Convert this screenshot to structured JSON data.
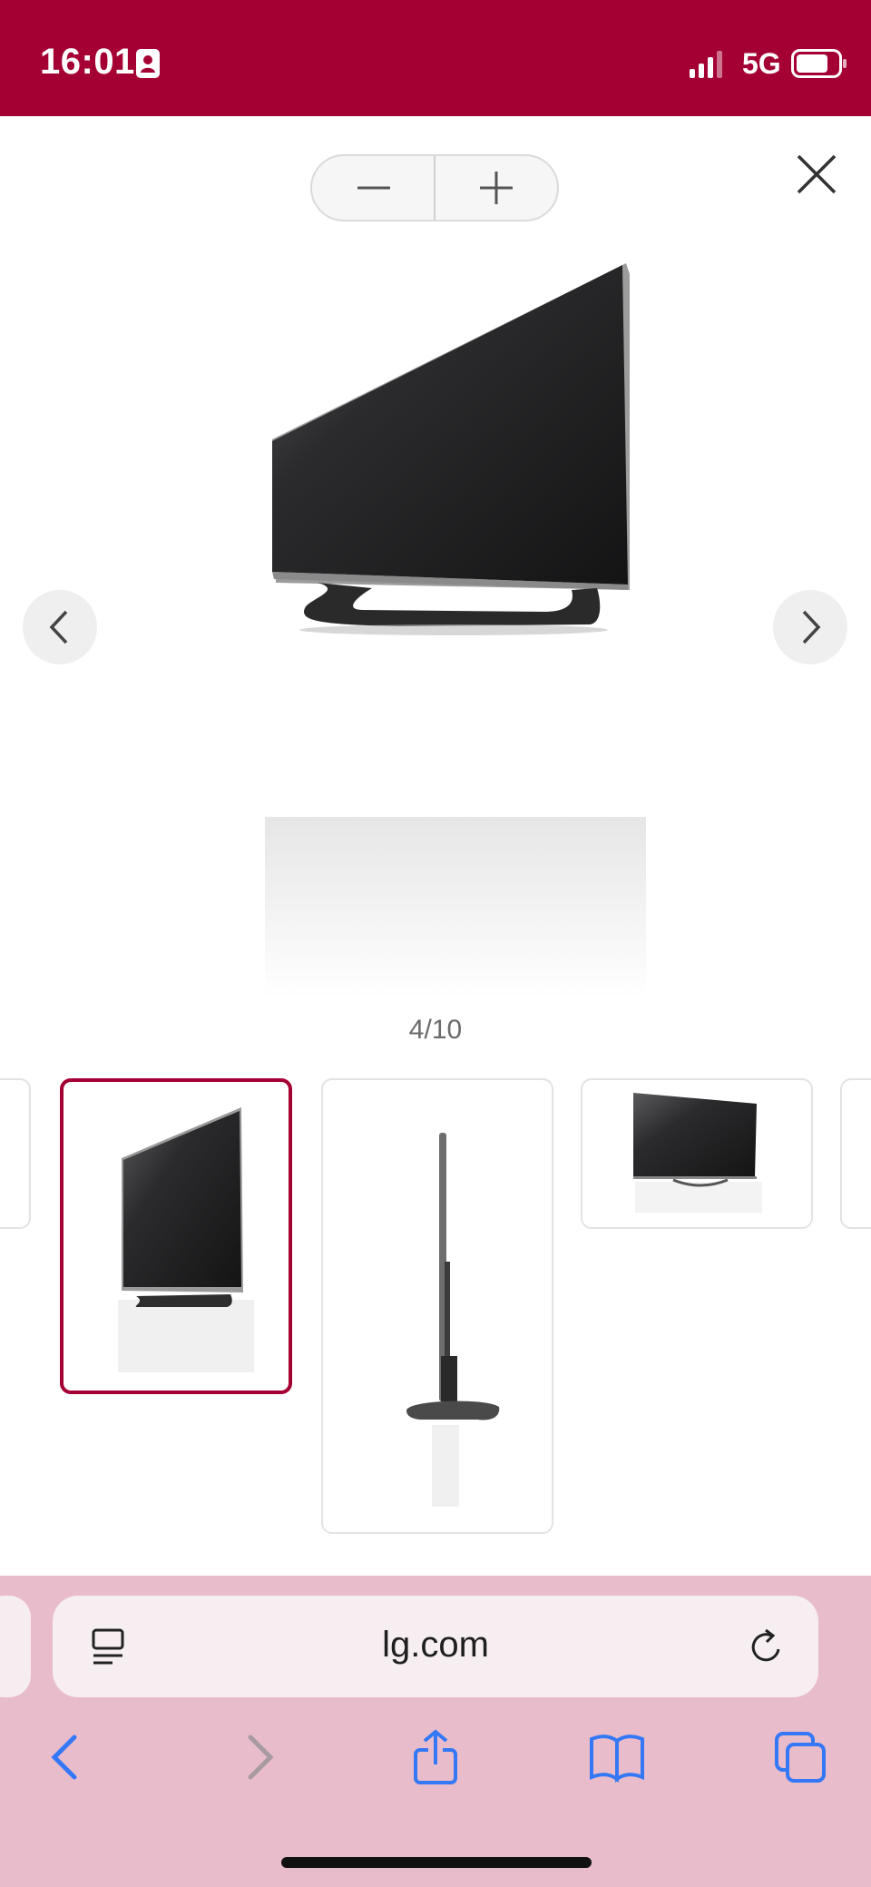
{
  "status_bar": {
    "time": "16:01",
    "network": "5G"
  },
  "viewer": {
    "counter": "4/10",
    "current_index": 4,
    "total": 10
  },
  "thumbnails": [
    {
      "label": "tv-angle-view",
      "active": true
    },
    {
      "label": "tv-side-view",
      "active": false
    },
    {
      "label": "tv-front-view",
      "active": false
    }
  ],
  "browser": {
    "url": "lg.com"
  },
  "colors": {
    "brand": "#a50034",
    "browser_tint": "#e9bccb",
    "toolbar_icon": "#3478f6"
  }
}
